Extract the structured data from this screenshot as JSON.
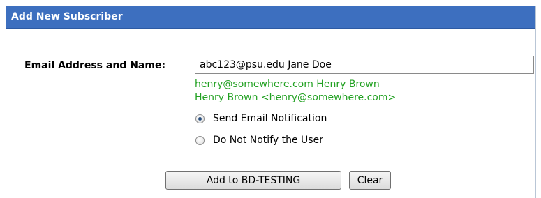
{
  "panel": {
    "title": "Add New Subscriber"
  },
  "form": {
    "email_label": "Email Address and Name:",
    "email_value": "abc123@psu.edu Jane Doe",
    "examples": [
      "henry@somewhere.com Henry Brown",
      "Henry Brown <henry@somewhere.com>"
    ],
    "example_color": "#22a122",
    "notification_options": [
      {
        "label": "Send Email Notification",
        "checked": true
      },
      {
        "label": "Do Not Notify the User",
        "checked": false
      }
    ]
  },
  "buttons": {
    "add_label": "Add to BD-TESTING",
    "clear_label": "Clear"
  },
  "colors": {
    "header_background": "#3d6fbf",
    "header_text": "#ffffff"
  }
}
